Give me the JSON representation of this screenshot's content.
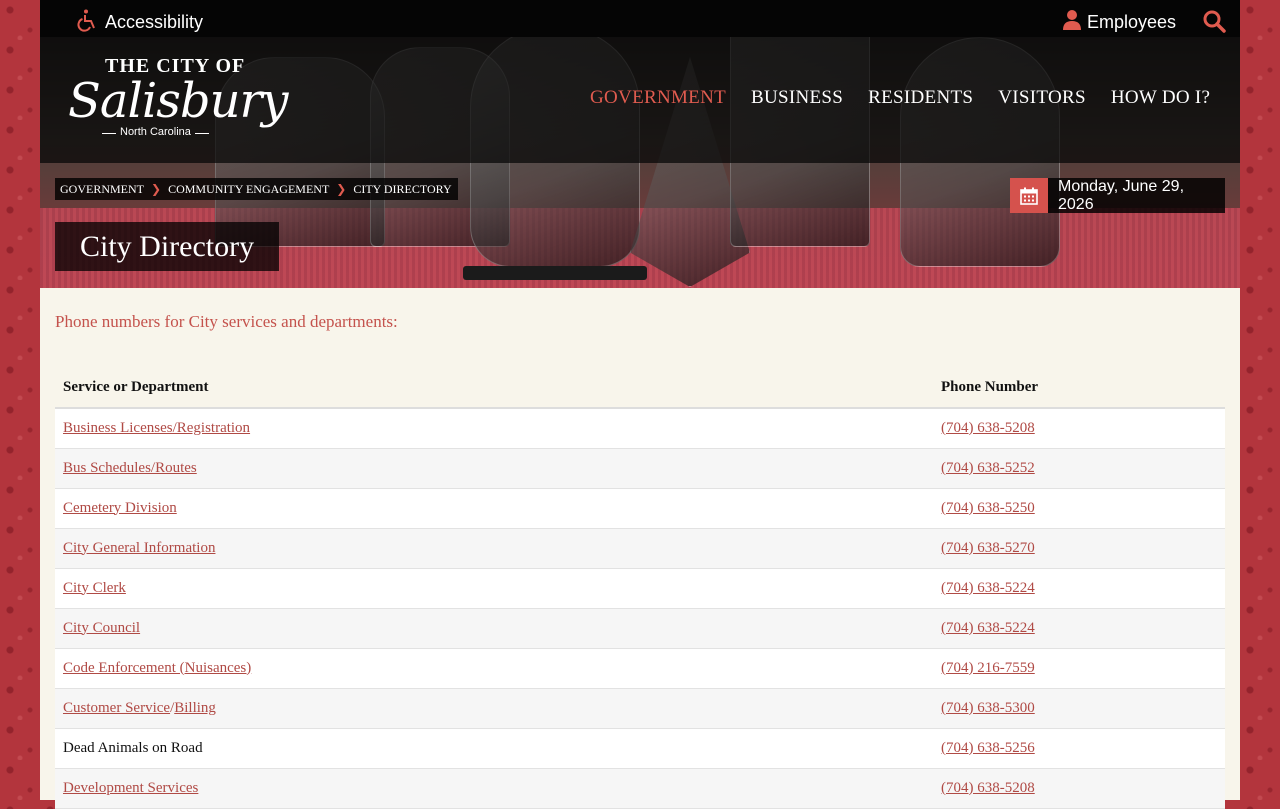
{
  "utility": {
    "accessibility_label": "Accessibility",
    "employees_label": "Employees"
  },
  "logo": {
    "line1": "THE CITY OF",
    "line2": "Salisbury",
    "line3": "North Carolina"
  },
  "nav": {
    "items": [
      {
        "label": "GOVERNMENT",
        "active": true
      },
      {
        "label": "BUSINESS",
        "active": false
      },
      {
        "label": "RESIDENTS",
        "active": false
      },
      {
        "label": "VISITORS",
        "active": false
      },
      {
        "label": "HOW DO I?",
        "active": false
      }
    ]
  },
  "breadcrumb": [
    "GOVERNMENT",
    "COMMUNITY ENGAGEMENT",
    "CITY DIRECTORY"
  ],
  "date": "Monday, June 29, 2026",
  "page_title": "City Directory",
  "intro": "Phone numbers for City services and departments:",
  "table": {
    "headers": [
      "Service or Department",
      "Phone Number"
    ],
    "rows": [
      {
        "service": "Business Licenses/Registration",
        "phone": "(704) 638-5208"
      },
      {
        "service": "Bus Schedules/Routes",
        "phone": "(704) 638-5252"
      },
      {
        "service": "Cemetery Division",
        "phone": "(704) 638-5250"
      },
      {
        "service": "City General Information",
        "phone": "(704) 638-5270"
      },
      {
        "service": "City Clerk",
        "phone": "(704) 638-5224"
      },
      {
        "service": "City Council",
        "phone": "(704) 638-5224"
      },
      {
        "service": "Code Enforcement (Nuisances)",
        "phone": "(704) 216-7559"
      },
      {
        "service_a": "Customer Service",
        "service_sep": "/",
        "service_b": "Billing",
        "phone": "(704) 638-5300"
      },
      {
        "service": "Dead Animals on Road",
        "phone": "(704) 638-5256"
      },
      {
        "service": "Development Services",
        "phone": "(704) 638-5208"
      }
    ]
  },
  "colors": {
    "accent": "#e05b4f",
    "link": "#b04a45",
    "background_pattern": "#b3353d"
  }
}
